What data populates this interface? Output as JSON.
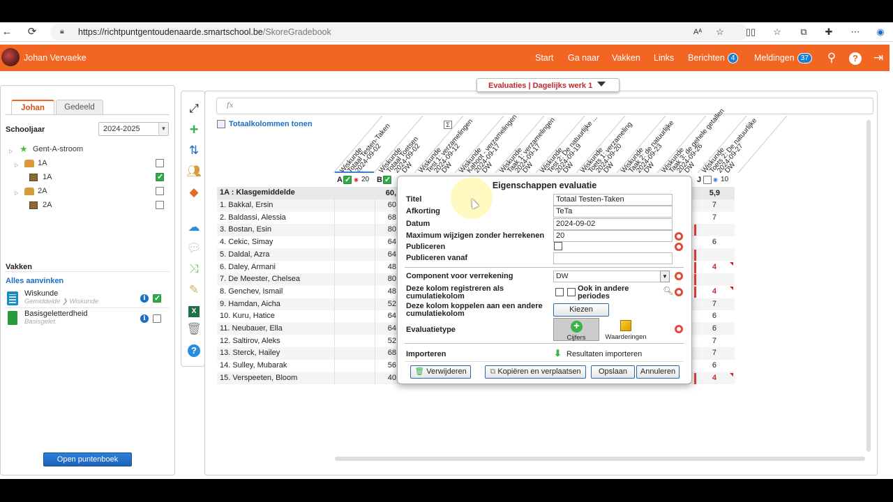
{
  "browser": {
    "url_main": "https://richtpuntgentoudenaarde.smartschool.be",
    "url_rest": "/SkoreGradebook"
  },
  "header": {
    "user": "Johan Vervaeke",
    "nav": [
      "Start",
      "Ga naar",
      "Vakken",
      "Links",
      "Berichten",
      "Meldingen"
    ],
    "berichten_count": "4",
    "meldingen_count": "37",
    "accent": "#f26522"
  },
  "left": {
    "tabs": [
      "Johan",
      "Gedeeld"
    ],
    "schooljaar_label": "Schooljaar",
    "schooljaar_value": "2024-2025",
    "tree": [
      {
        "label": "Gent-A-stroom"
      },
      {
        "label": "1A"
      },
      {
        "label": "1A",
        "checked": true
      },
      {
        "label": "2A"
      },
      {
        "label": "2A"
      }
    ],
    "vakken_label": "Vakken",
    "alles_aanvinken": "Alles aanvinken",
    "subjects": [
      {
        "name": "Wiskunde",
        "sub": "Gemiddelde",
        "sub2": "Wiskunde",
        "checked": true
      },
      {
        "name": "Basisgeletterdheid",
        "sub": "Basisgelet.",
        "checked": false
      }
    ],
    "open_button": "Open puntenboek"
  },
  "main": {
    "eval_selector": "Evaluaties | Dagelijks werk 1",
    "fx": "fx",
    "totaal_label": "Totaalkolommen tonen",
    "columns": [
      [
        "Wiskunde",
        "Totaal Testen-Taken",
        "2024-09-02"
      ],
      [
        "Wiskunde",
        "Totaal Toetsen",
        "2024-09-02",
        "DW"
      ],
      [
        "Wiskunde",
        "Test 1: verzamelingen",
        "2024-09-12",
        "DW"
      ],
      [
        "Wiskunde",
        "Kahoot - verzamelingen",
        "2024-09-17",
        "DW"
      ],
      [
        "Wiskunde",
        "Taak 1: verzamelingen",
        "2024-09-17",
        "DW"
      ],
      [
        "Wiskunde",
        "Test 2: De natuurlijke ...",
        "2024-09-19",
        "DW"
      ],
      [
        "Wiskunde",
        "Toets 1: verzameling",
        "2024-09-20",
        "DW"
      ],
      [
        "Wiskunde",
        "Taak 2: de natuurlijke",
        "2024-09-23",
        "DW"
      ],
      [
        "Wiskunde",
        "Taak 3: de gehele getallen",
        "2024-09-26",
        "DW"
      ],
      [
        "Wiskunde",
        "Toets 2: De natuurlijke",
        "2024-09-27",
        "DW"
      ]
    ],
    "col_a": {
      "letter": "A",
      "max": "20"
    },
    "col_b": {
      "letter": "B"
    },
    "col_j": {
      "letter": "J",
      "max": "10"
    },
    "class_row": {
      "label": "1A : Klasgemiddelde",
      "b": "60,",
      "j": "5,9"
    },
    "students": [
      {
        "name": "1. Bakkal, Ersin",
        "b": "60",
        "j": "7"
      },
      {
        "name": "2. Baldassi, Alessia",
        "b": "68",
        "j": "7"
      },
      {
        "name": "3. Bostan, Esin",
        "b": "80",
        "j": ""
      },
      {
        "name": "4. Cekic, Simay",
        "b": "64",
        "j": "6"
      },
      {
        "name": "5. Daldal, Azra",
        "b": "64",
        "j": ""
      },
      {
        "name": "6. Daley, Armani",
        "b": "48",
        "j": "4",
        "red": true
      },
      {
        "name": "7. De Meester, Chelsea",
        "b": "80",
        "j": ""
      },
      {
        "name": "8. Genchev, Ismail",
        "b": "48",
        "j": "4",
        "red": true
      },
      {
        "name": "9. Hamdan, Aicha",
        "b": "52",
        "j": "7"
      },
      {
        "name": "10. Kuru, Hatice",
        "b": "64",
        "j": "6"
      },
      {
        "name": "11. Neubauer, Ella",
        "b": "64",
        "j": "6"
      },
      {
        "name": "12. Saltirov, Aleks",
        "b": "52",
        "j": "7"
      },
      {
        "name": "13. Sterck, Hailey",
        "b": "68",
        "j": "7"
      },
      {
        "name": "14. Sulley, Mubarak",
        "b": "56",
        "j": "6"
      },
      {
        "name": "15. Verspeeten, Bloom",
        "b": "40",
        "j": "4",
        "red": true
      }
    ]
  },
  "dialog": {
    "title": "Eigenschappen evaluatie",
    "titel_label": "Titel",
    "titel_value": "Totaal Testen-Taken",
    "afkorting_label": "Afkorting",
    "afkorting_value": "TeTa",
    "datum_label": "Datum",
    "datum_value": "2024-09-02",
    "maximum_label": "Maximum wijzigen zonder herrekenen",
    "maximum_value": "20",
    "publiceren_label": "Publiceren",
    "publiceren_vanaf_label": "Publiceren vanaf",
    "component_label": "Component voor verrekening",
    "component_value": "DW",
    "cumul_reg_label": "Deze kolom registreren als cumulatiekolom",
    "ook_andere": "Ook in andere periodes",
    "cumul_koppel_label": "Deze kolom koppelen aan een andere cumulatiekolom",
    "kiezen": "Kiezen",
    "evaluatietype_label": "Evaluatietype",
    "type_cijfers": "Cijfers",
    "type_waarderingen": "Waarderingen",
    "importeren_label": "Importeren",
    "resultaten_importeren": "Resultaten importeren",
    "btn_verwijderen": "Verwijderen",
    "btn_kopieren": "Kopiëren en verplaatsen",
    "btn_opslaan": "Opslaan",
    "btn_annuleren": "Annuleren"
  }
}
